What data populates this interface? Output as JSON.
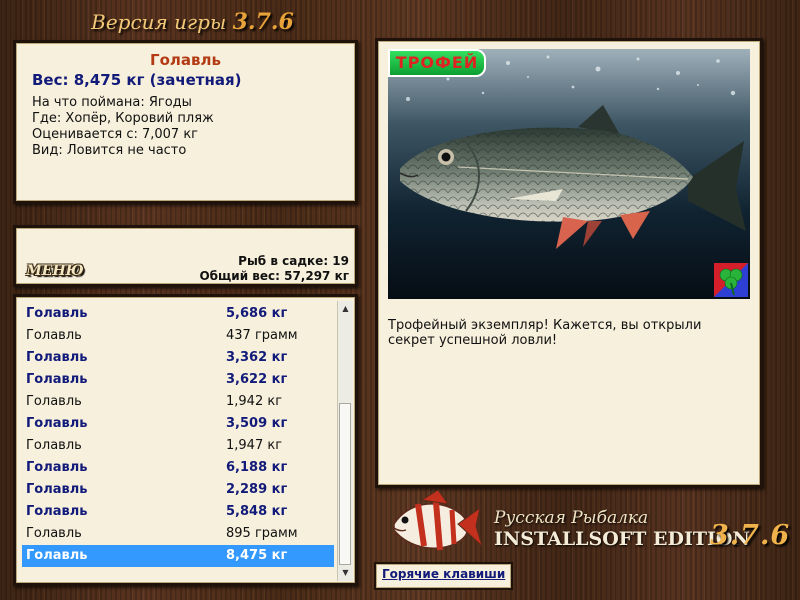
{
  "header": {
    "version_label": "Версия игры",
    "version_number": "3.7.6"
  },
  "fish_info": {
    "name": "Голавль",
    "weight": "Вес: 8,475 кг (зачетная)",
    "lines": [
      "На что поймана: Ягоды",
      "Где: Хопёр, Коровий пляж",
      "Оценивается с: 7,007 кг",
      "Вид: Ловится не часто"
    ]
  },
  "keepnet": {
    "menu_label": "МЕНЮ",
    "fish_count": "Рыб в садке: 19",
    "total_weight": "Общий вес: 57,297 кг"
  },
  "catch_list": [
    {
      "name": "Голавль",
      "weight": "5,686 кг",
      "bold": true
    },
    {
      "name": "Голавль",
      "weight": "437 грамм",
      "bold": false
    },
    {
      "name": "Голавль",
      "weight": "3,362 кг",
      "bold": true
    },
    {
      "name": "Голавль",
      "weight": "3,622 кг",
      "bold": true
    },
    {
      "name": "Голавль",
      "weight": "1,942 кг",
      "bold": false
    },
    {
      "name": "Голавль",
      "weight": "3,509 кг",
      "bold": true
    },
    {
      "name": "Голавль",
      "weight": "1,947 кг",
      "bold": false
    },
    {
      "name": "Голавль",
      "weight": "6,188 кг",
      "bold": true
    },
    {
      "name": "Голавль",
      "weight": "2,289 кг",
      "bold": true
    },
    {
      "name": "Голавль",
      "weight": "5,848 кг",
      "bold": true
    },
    {
      "name": "Голавль",
      "weight": "895 грамм",
      "bold": false
    },
    {
      "name": "Голавль",
      "weight": "8,475 кг",
      "bold": true,
      "selected": true
    }
  ],
  "picture": {
    "trophy_badge": "ТРОФЕЙ",
    "description": "Трофейный экземпляр! Кажется, вы открыли секрет успешной ловли!"
  },
  "brand": {
    "line1": "Русская Рыбалка",
    "line2": "INSTALLSOFT EDITION",
    "version": "3.7.6"
  },
  "hotkeys_label": "Горячие клавиши",
  "colors": {
    "selection": "#3399ff",
    "fish_name": "#b33a12",
    "bold_row": "#121a7a",
    "panel_bg": "#f6f0dc"
  }
}
